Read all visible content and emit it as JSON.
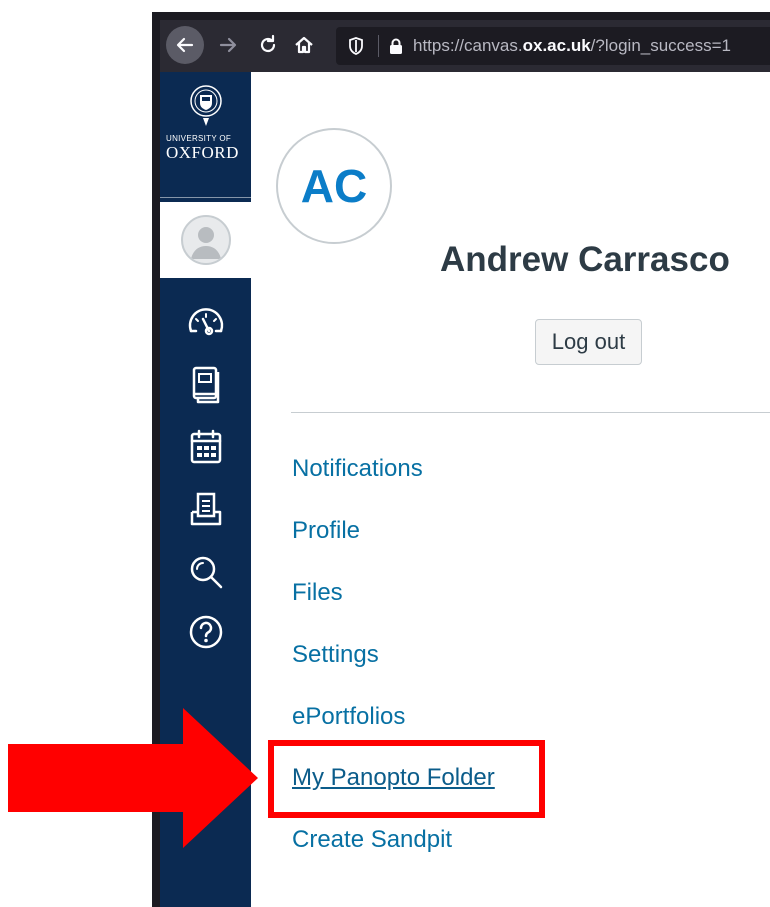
{
  "browser": {
    "url_prefix": "https://canvas.",
    "url_host": "ox.ac.uk",
    "url_suffix": "/?login_success=1"
  },
  "brand": {
    "line1": "UNIVERSITY OF",
    "line2": "OXFORD"
  },
  "global_nav": {
    "items": [
      {
        "name": "account",
        "icon": "user-avatar-icon"
      },
      {
        "name": "dashboard",
        "icon": "speedometer-icon"
      },
      {
        "name": "courses",
        "icon": "book-icon"
      },
      {
        "name": "calendar",
        "icon": "calendar-icon"
      },
      {
        "name": "inbox",
        "icon": "inbox-icon"
      },
      {
        "name": "search",
        "icon": "magnifier-icon"
      },
      {
        "name": "help",
        "icon": "question-icon"
      }
    ]
  },
  "account_tray": {
    "initials": "AC",
    "user_name": "Andrew Carrasco",
    "logout_label": "Log out",
    "links": [
      {
        "label": "Notifications"
      },
      {
        "label": "Profile"
      },
      {
        "label": "Files"
      },
      {
        "label": "Settings"
      },
      {
        "label": "ePortfolios"
      },
      {
        "label": "My Panopto Folder",
        "highlighted": true
      },
      {
        "label": "Create Sandpit"
      }
    ]
  },
  "colors": {
    "nav_bg": "#0b2a52",
    "link": "#0770a3",
    "annotation": "#ff0000"
  }
}
